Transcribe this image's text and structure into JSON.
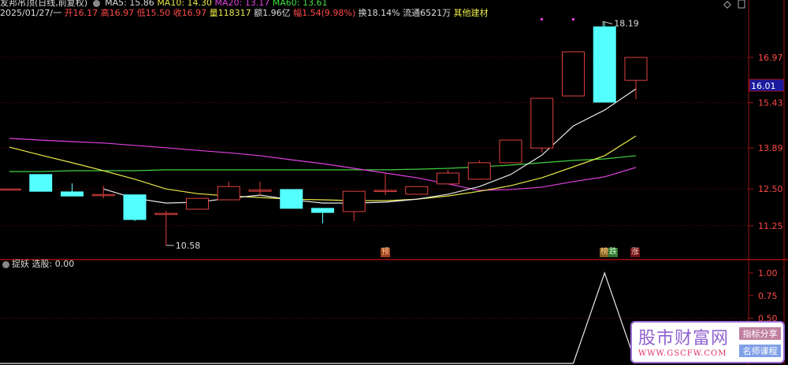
{
  "header": {
    "title": "友邦吊顶(日线,前复权)",
    "ma5": "MA5: 15.86",
    "ma10": "MA10: 14.30",
    "ma20": "MA20: 13.17",
    "ma60": "MA60: 13.61",
    "date": "2025/01/27/一",
    "open_label": "开",
    "open": "16.17",
    "high_label": "高",
    "high": "16.97",
    "low_label": "低",
    "low": "15.50",
    "close_label": "收",
    "close": "16.97",
    "vol_label": "量",
    "vol": "118317",
    "amt": "额1.96亿",
    "chg_label": "幅",
    "chg": "1.54(9.98%)",
    "turnover": "换18.14%",
    "float": "流通6521万",
    "sector": "其他建材"
  },
  "price_axis": {
    "ticks": [
      "16.97",
      "15.43",
      "13.89",
      "12.50",
      "11.25"
    ],
    "current": "16.01"
  },
  "annotations": {
    "high": "18.19",
    "low": "10.58",
    "badge1": "预",
    "badge2": "榜",
    "badge3": "跌",
    "badge4": "涨"
  },
  "indicator": {
    "name": "捉妖",
    "label": "选股: 0.00",
    "ticks": [
      "1.00",
      "0.75",
      "0.50"
    ]
  },
  "watermark": {
    "title": "股市财富网",
    "url": "WWW.GSCFW.COM",
    "tag1": "指标分享",
    "tag2": "名师课程"
  },
  "colors": {
    "up": "#e04040",
    "down": "#54ffff",
    "ma5": "#e8e8e8",
    "ma10": "#e8e84a",
    "ma20": "#e040e0",
    "ma60": "#40d040"
  },
  "chart_data": {
    "type": "candlestick",
    "candles": [
      [
        12.5,
        12.91,
        12.91,
        12.5
      ],
      [
        12.99,
        12.99,
        12.42,
        12.42
      ],
      [
        12.4,
        12.69,
        12.24,
        12.26
      ],
      [
        12.29,
        12.61,
        12.18,
        12.31
      ],
      [
        12.3,
        12.3,
        11.41,
        11.46
      ],
      [
        11.65,
        11.76,
        10.58,
        11.67
      ],
      [
        11.81,
        12.18,
        11.81,
        12.18
      ],
      [
        12.13,
        12.75,
        12.13,
        12.58
      ],
      [
        12.44,
        12.75,
        12.29,
        12.46
      ],
      [
        12.48,
        12.48,
        11.84,
        11.84
      ],
      [
        11.84,
        11.84,
        11.33,
        11.7
      ],
      [
        11.73,
        12.42,
        11.41,
        12.42
      ],
      [
        12.42,
        13.01,
        12.29,
        12.45
      ],
      [
        12.32,
        12.58,
        12.32,
        12.58
      ],
      [
        12.67,
        13.15,
        12.67,
        13.04
      ],
      [
        12.83,
        13.47,
        12.83,
        13.39
      ],
      [
        13.39,
        14.16,
        13.39,
        14.16
      ],
      [
        13.89,
        15.58,
        13.73,
        15.58
      ],
      [
        15.66,
        17.16,
        15.66,
        17.16
      ],
      [
        18.01,
        18.19,
        15.45,
        15.45
      ],
      [
        16.19,
        16.97,
        15.55,
        16.97
      ]
    ],
    "ma5": [
      null,
      null,
      null,
      12.5,
      12.18,
      12.02,
      12.05,
      12.18,
      12.29,
      12.13,
      12.02,
      12.02,
      12.05,
      12.15,
      12.32,
      12.58,
      12.99,
      13.65,
      14.64,
      15.18,
      15.9
    ],
    "ma10": [
      13.92,
      13.65,
      13.39,
      13.12,
      12.83,
      12.5,
      12.34,
      12.26,
      12.21,
      12.15,
      12.13,
      12.1,
      12.1,
      12.15,
      12.26,
      12.42,
      12.61,
      12.88,
      13.25,
      13.63,
      14.3
    ],
    "ma20": [
      14.22,
      14.16,
      14.11,
      14.06,
      13.98,
      13.9,
      13.81,
      13.73,
      13.63,
      13.49,
      13.36,
      13.2,
      13.04,
      12.88,
      12.67,
      12.45,
      12.48,
      12.56,
      12.75,
      12.91,
      13.23
    ],
    "ma60": [
      13.09,
      13.09,
      13.12,
      13.12,
      13.12,
      13.15,
      13.15,
      13.15,
      13.15,
      13.15,
      13.15,
      13.15,
      13.15,
      13.17,
      13.2,
      13.25,
      13.31,
      13.39,
      13.47,
      13.52,
      13.63
    ],
    "indicator": [
      0,
      0,
      0,
      0,
      0,
      0,
      0,
      0,
      0,
      0,
      0,
      0,
      0,
      0,
      0,
      0,
      0,
      0,
      0,
      1,
      0
    ],
    "ylim": [
      10.3,
      18.3
    ],
    "indicator_ylim": [
      0,
      1
    ]
  }
}
